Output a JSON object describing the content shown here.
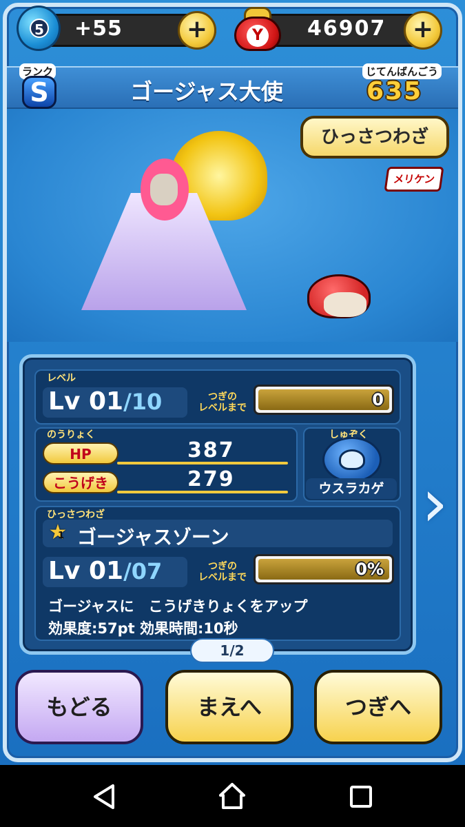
{
  "topbar": {
    "level_badge": "5",
    "coins": "+55",
    "money": "46907",
    "plus_symbol": "+",
    "money_glyph": "Y"
  },
  "header": {
    "rank_label": "ランク",
    "rank_value": "S",
    "character_name": "ゴージャス大使",
    "dex_label": "じてんばんごう",
    "dex_number": "635"
  },
  "stage": {
    "special_button": "ひっさつわざ",
    "tribe_tag": "メリケン"
  },
  "level": {
    "caption": "レベル",
    "lv_prefix": "Lv",
    "current": "01",
    "max": "/10",
    "next_label_1": "つぎの",
    "next_label_2": "レベルまで",
    "next_value": "0"
  },
  "power": {
    "caption": "のうりょく",
    "hp_label": "HP",
    "hp_value": "387",
    "attack_label": "こうげき",
    "attack_value": "279"
  },
  "tribe": {
    "caption": "しゅぞく",
    "name": "ウスラカゲ"
  },
  "skill": {
    "caption": "ひっさつわざ",
    "star_rank": "1",
    "name": "ゴージャスゾーン",
    "lv_prefix": "Lv",
    "current": "01",
    "max": "/07",
    "next_label_1": "つぎの",
    "next_label_2": "レベルまで",
    "next_value": "0%",
    "description": "ゴージャスに　こうげきりょくをアップ",
    "effect": "効果度:57pt 効果時間:10秒"
  },
  "pager": "1/2",
  "buttons": {
    "back": "もどる",
    "prev": "まえへ",
    "next": "つぎへ"
  },
  "colors": {
    "bg_blue": "#2d8fd8",
    "gold": "#f1c93e",
    "panel": "#1a4e86"
  }
}
